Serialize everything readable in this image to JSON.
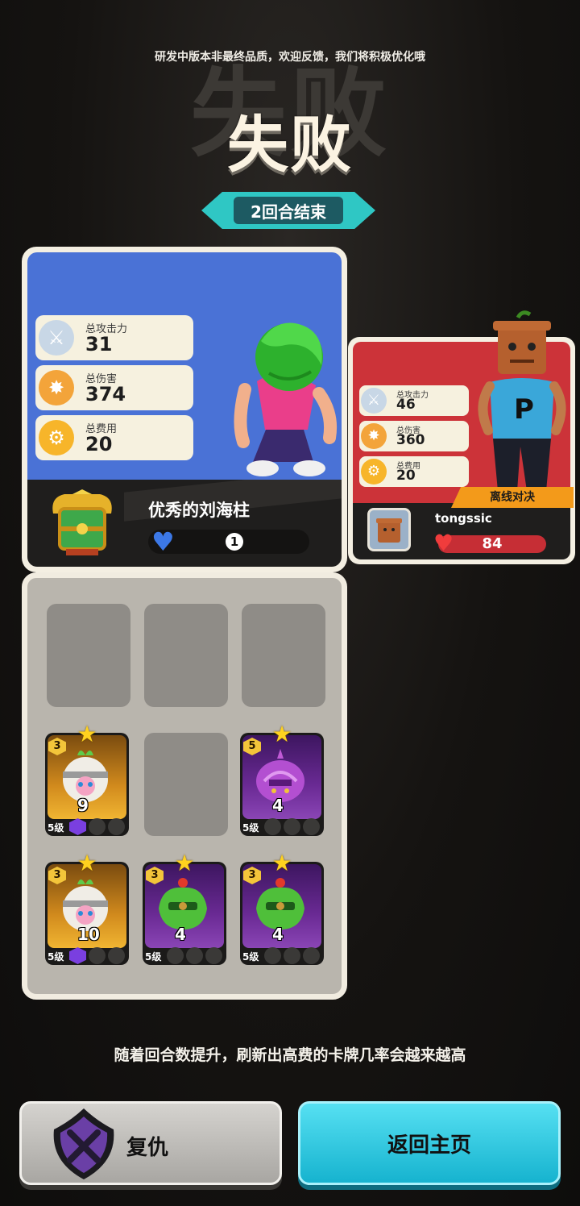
{
  "notice": "研发中版本非最终品质，欢迎反馈，我们将积极优化哦",
  "result_title": "失败",
  "round_banner": "2回合结束",
  "player": {
    "name": "优秀的刘海柱",
    "hp": "1",
    "stats": [
      {
        "label": "总攻击力",
        "value": "31",
        "icon": "sword-fist-icon"
      },
      {
        "label": "总伤害",
        "value": "374",
        "icon": "explosion-target-icon"
      },
      {
        "label": "总费用",
        "value": "20",
        "icon": "gear-coin-icon"
      }
    ],
    "colors": {
      "panel": "#4a72d6",
      "heart": "#3c78e6"
    }
  },
  "opponent": {
    "name": "tongssic",
    "hp": "84",
    "tag": "离线对决",
    "stats": [
      {
        "label": "总攻击力",
        "value": "46",
        "icon": "sword-fist-icon"
      },
      {
        "label": "总伤害",
        "value": "360",
        "icon": "explosion-target-icon"
      },
      {
        "label": "总费用",
        "value": "20",
        "icon": "gear-coin-icon"
      }
    ],
    "colors": {
      "panel": "#cc3339",
      "heart": "#f03c3c"
    }
  },
  "board": {
    "cards": [
      {
        "cost": "3",
        "attack": "9",
        "level": "5级",
        "rarity": "gold",
        "creature": "radish"
      },
      {
        "cost": "5",
        "attack": "4",
        "level": "5级",
        "rarity": "purple",
        "creature": "onion"
      },
      {
        "cost": "3",
        "attack": "10",
        "level": "5级",
        "rarity": "gold",
        "creature": "radish"
      },
      {
        "cost": "3",
        "attack": "4",
        "level": "5级",
        "rarity": "purple",
        "creature": "cabbage"
      },
      {
        "cost": "3",
        "attack": "4",
        "level": "5级",
        "rarity": "purple",
        "creature": "cabbage"
      }
    ]
  },
  "hint": "随着回合数提升，刷新出高费的卡牌几率会越来越高",
  "buttons": {
    "revenge": "复仇",
    "home": "返回主页"
  }
}
